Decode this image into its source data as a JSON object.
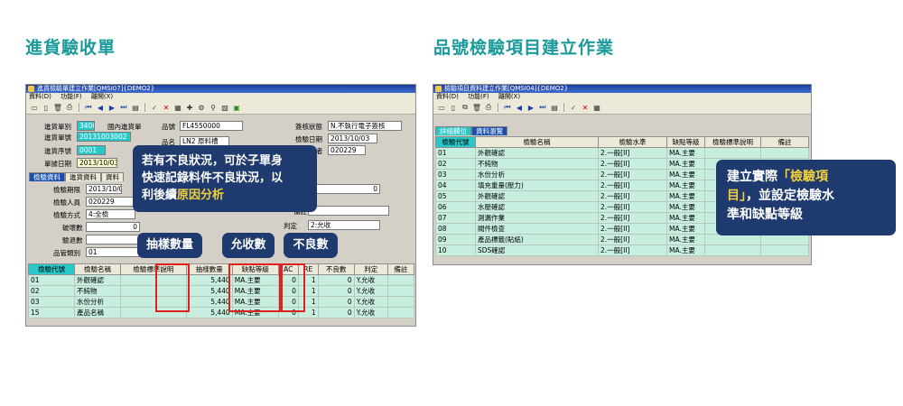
{
  "left": {
    "heading": "進貨驗收單",
    "window_title": "進貨檢驗單建立作業[QMSI07]{DEMO2}",
    "menu": [
      "資料(D)",
      "功能(F)",
      "離開(X)"
    ],
    "fields": {
      "doc_type_label": "進貨單別",
      "doc_type": "3400",
      "doc_type_desc": "國內進貨單",
      "doc_no_label": "進貨單號",
      "doc_no": "20131003002",
      "seq_label": "進貨序號",
      "seq": "0001",
      "date_label": "單據日期",
      "date": "2013/10/03",
      "part_label": "品號",
      "part": "FL4550000",
      "name_label": "品名",
      "name": "LN2 原料槽",
      "status_label": "簽核狀態",
      "status": "N.不執行電子簽核",
      "inspect_date_label": "檢驗日期",
      "inspect_date": "2013/10/03",
      "inspector_label": "檢驗者",
      "inspector": "020229"
    },
    "tabs": [
      "檢驗資料",
      "進貨資料",
      "資料"
    ],
    "detail": {
      "period_label": "檢驗期限",
      "period": "2013/10/03",
      "person_label": "檢驗人員",
      "person": "020229",
      "method_label": "檢驗方式",
      "method": "4:全檢",
      "damage_label": "破壞數",
      "damage": "0",
      "return_label": "驗退數",
      "mgmt_label": "品管類別",
      "mgmt": "01",
      "note_label": "備註",
      "judge_label": "判定",
      "judge": "2:允收",
      "zero": "0"
    },
    "grid_headers": [
      "檢驗代號",
      "檢驗名稱",
      "檢驗標準說明",
      "抽樣數量",
      "缺點等級",
      "AC",
      "RE",
      "不良數",
      "判定",
      "備註"
    ],
    "grid_rows": [
      [
        "01",
        "外觀確認",
        "",
        "5,440",
        "MA.主要",
        "0",
        "1",
        "0",
        "Y.允收",
        ""
      ],
      [
        "02",
        "不純物",
        "",
        "5,440",
        "MA.主要",
        "0",
        "1",
        "0",
        "Y.允收",
        ""
      ],
      [
        "03",
        "水份分析",
        "",
        "5,440",
        "MA.主要",
        "0",
        "1",
        "0",
        "Y.允收",
        ""
      ],
      [
        "15",
        "產品名稱",
        "",
        "5,440",
        "MA.主要",
        "0",
        "1",
        "0",
        "Y.允收",
        ""
      ]
    ],
    "callout_main_line1": "若有不良狀況，可於子單身",
    "callout_main_line2": "快速記錄料件不良狀況，以",
    "callout_main_line3a": "利後續",
    "callout_main_highlight": "原因分析",
    "callout_sample": "抽樣數量",
    "callout_accept": "允收數",
    "callout_defect": "不良數"
  },
  "right": {
    "heading": "品號檢驗項目建立作業",
    "window_title": "檢驗項目資料建立作業[QMSI04]{DEMO2}",
    "menu": [
      "資料(D)",
      "功能(F)",
      "離開(X)"
    ],
    "tabs": [
      "詳細欄位",
      "資料瀏覽"
    ],
    "grid_headers": [
      "檢驗代號",
      "檢驗名稱",
      "檢驗水準",
      "缺點等級",
      "檢驗標準說明",
      "備註"
    ],
    "grid_rows": [
      [
        "01",
        "外觀確認",
        "2.一般[II]",
        "MA.主要",
        "",
        ""
      ],
      [
        "02",
        "不純物",
        "2.一般[II]",
        "MA.主要",
        "",
        ""
      ],
      [
        "03",
        "水份分析",
        "2.一般[II]",
        "MA.主要",
        "",
        ""
      ],
      [
        "04",
        "填充重量(壓力)",
        "2.一般[II]",
        "MA.主要",
        "",
        ""
      ],
      [
        "05",
        "外觀確認",
        "2.一般[II]",
        "MA.主要",
        "",
        ""
      ],
      [
        "06",
        "水壓確認",
        "2.一般[II]",
        "MA.主要",
        "",
        ""
      ],
      [
        "07",
        "測漏作業",
        "2.一般[II]",
        "MA.主要",
        "",
        ""
      ],
      [
        "08",
        "閥件檢查",
        "2.一般[II]",
        "MA.主要",
        "",
        ""
      ],
      [
        "09",
        "產品標籤(貼紙)",
        "2.一般[II]",
        "MA.主要",
        "",
        ""
      ],
      [
        "10",
        "SDS確認",
        "2.一般[II]",
        "MA.主要",
        "",
        ""
      ]
    ],
    "callout_line1a": "建立實際",
    "callout_highlight1": "「檢驗項",
    "callout_highlight2": "目」",
    "callout_line2b": "，並設定檢驗水",
    "callout_line3": "準和缺點等級"
  },
  "colors": {
    "heading": "#1b9a9c",
    "callout": "#1f3a6e",
    "highlight": "#f2d13c",
    "alert": "#e02020",
    "grid_teal": "#c8eee0"
  }
}
